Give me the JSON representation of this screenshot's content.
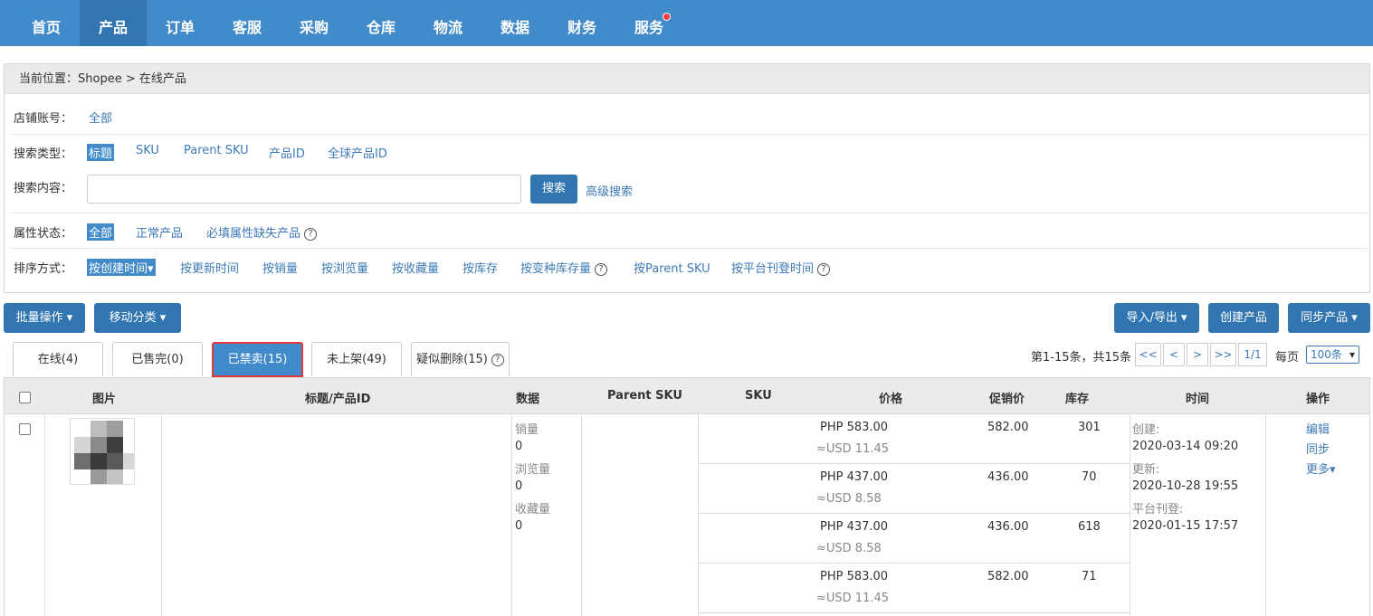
{
  "nav": {
    "items": [
      "首页",
      "产品",
      "订单",
      "客服",
      "采购",
      "仓库",
      "物流",
      "数据",
      "财务",
      "服务"
    ],
    "active_index": 1
  },
  "breadcrumb": {
    "prefix": "当前位置：",
    "path": "Shopee > 在线产品"
  },
  "filters": {
    "shop": {
      "label": "店铺账号：",
      "options": [
        "全部"
      ]
    },
    "search_type": {
      "label": "搜索类型：",
      "options": [
        "标题",
        "SKU",
        "Parent SKU",
        "产品ID",
        "全球产品ID"
      ]
    },
    "search_content": {
      "label": "搜索内容：",
      "value": "",
      "button": "搜索",
      "advanced": "高级搜索"
    },
    "attr_status": {
      "label": "属性状态：",
      "options": [
        "全部",
        "正常产品",
        "必填属性缺失产品"
      ]
    },
    "sort": {
      "label": "排序方式：",
      "options": [
        "按创建时间▾",
        "按更新时间",
        "按销量",
        "按浏览量",
        "按收藏量",
        "按库存",
        "按变种库存量",
        "按Parent SKU",
        "按平台刊登时间"
      ]
    }
  },
  "toolbar": {
    "batch": "批量操作 ▾",
    "move": "移动分类 ▾",
    "import_export": "导入/导出 ▾",
    "create": "创建产品",
    "sync": "同步产品 ▾"
  },
  "tabs": [
    "在线(4)",
    "已售完(0)",
    "已禁卖(15)",
    "未上架(49)",
    "疑似删除(15)"
  ],
  "active_tab_index": 2,
  "pagination": {
    "summary": "第1-15条，共15条",
    "first": "<<",
    "prev": "<",
    "next": ">",
    "last": ">>",
    "page": "1/1",
    "per_page_label": "每页",
    "per_page": "100条"
  },
  "table": {
    "headers": [
      "图片",
      "标题/产品ID",
      "数据",
      "Parent SKU",
      "SKU",
      "价格",
      "促销价",
      "库存",
      "时间",
      "操作"
    ],
    "row": {
      "stats": [
        "销量",
        "0",
        "浏览量",
        "0",
        "收藏量",
        "0"
      ],
      "variants": [
        {
          "price": "PHP   583.00",
          "usd": "≈USD 11.45",
          "promo": "582.00",
          "stock": "301"
        },
        {
          "price": "PHP   437.00",
          "usd": "≈USD 8.58",
          "promo": "436.00",
          "stock": "70"
        },
        {
          "price": "PHP   437.00",
          "usd": "≈USD 8.58",
          "promo": "436.00",
          "stock": "618"
        },
        {
          "price": "PHP   583.00",
          "usd": "≈USD 11.45",
          "promo": "582.00",
          "stock": "71"
        }
      ],
      "times": [
        "创建:",
        "2020-03-14 09:20",
        "更新:",
        "2020-10-28 19:55",
        "平台刊登:",
        "2020-01-15 17:57"
      ],
      "actions": [
        "编辑",
        "同步",
        "更多▾"
      ]
    }
  }
}
